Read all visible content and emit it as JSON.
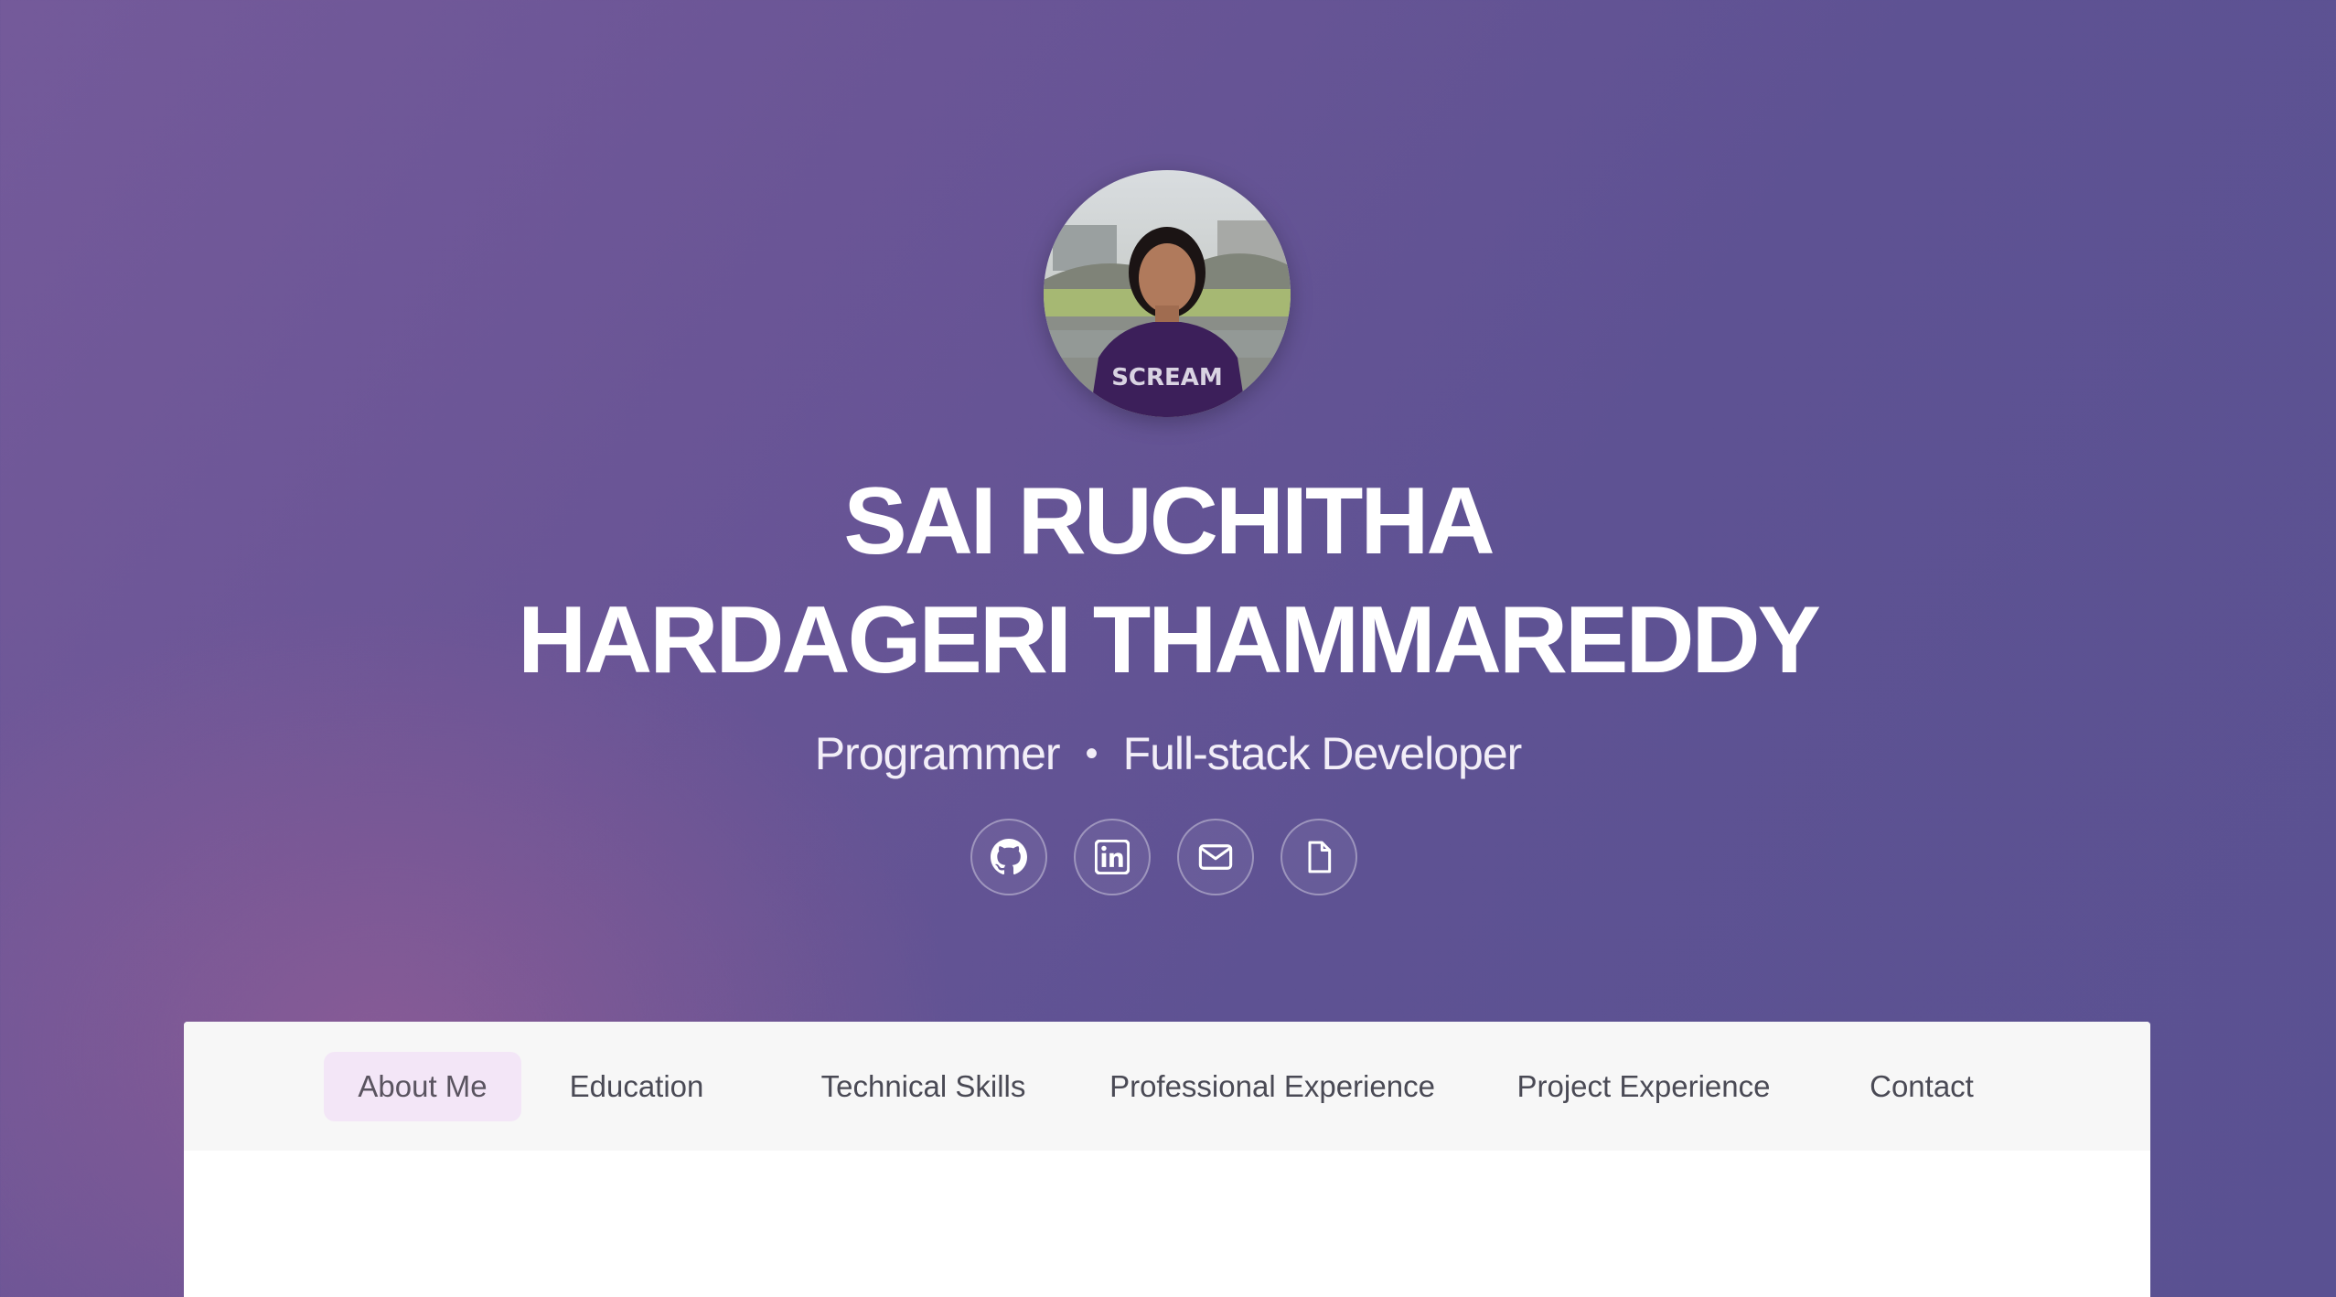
{
  "profile": {
    "name_line1": "SAI RUCHITHA",
    "name_line2": "HARDAGERI THAMMAREDDY",
    "role1": "Programmer",
    "separator": "•",
    "role2": "Full-stack Developer",
    "avatar_alt": "Profile photo"
  },
  "socials": [
    {
      "icon": "github-icon"
    },
    {
      "icon": "linkedin-icon"
    },
    {
      "icon": "mail-icon"
    },
    {
      "icon": "document-icon"
    }
  ],
  "nav": {
    "items": [
      {
        "label": "About Me",
        "active": true
      },
      {
        "label": "Education",
        "active": false
      },
      {
        "label": "Technical Skills",
        "active": false
      },
      {
        "label": "Professional Experience",
        "active": false
      },
      {
        "label": "Project Experience",
        "active": false
      },
      {
        "label": "Contact",
        "active": false
      }
    ]
  },
  "colors": {
    "accent": "#5e5293",
    "nav_active_bg": "#f3e6f7",
    "nav_bg": "#f7f7f7"
  }
}
